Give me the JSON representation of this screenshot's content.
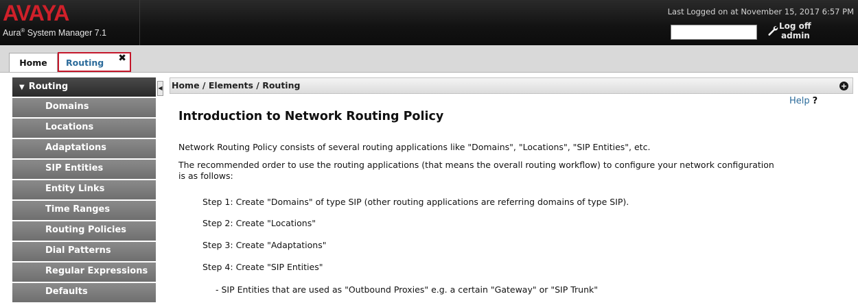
{
  "header": {
    "logo": "AVAYA",
    "product_name": "Aura",
    "product_reg": "®",
    "product_suffix": " System Manager 7.1",
    "last_logged": "Last Logged on at November 15, 2017 6:57 PM",
    "search_value": "",
    "logoff_label": "Log off",
    "user": "admin",
    "icons": {
      "logoff": "wrench-icon"
    }
  },
  "tabs": [
    {
      "label": "Home",
      "active": false
    },
    {
      "label": "Routing",
      "active": true,
      "close": "✖"
    }
  ],
  "sidebar": {
    "title": "Routing",
    "items": [
      {
        "label": "Domains"
      },
      {
        "label": "Locations"
      },
      {
        "label": "Adaptations"
      },
      {
        "label": "SIP Entities"
      },
      {
        "label": "Entity Links"
      },
      {
        "label": "Time Ranges"
      },
      {
        "label": "Routing Policies"
      },
      {
        "label": "Dial Patterns"
      },
      {
        "label": "Regular Expressions"
      },
      {
        "label": "Defaults"
      }
    ]
  },
  "main": {
    "breadcrumb": "Home / Elements / Routing",
    "help_label": "Help",
    "help_q": "?",
    "title": "Introduction to Network Routing Policy",
    "para1": "Network Routing Policy consists of several routing applications like \"Domains\", \"Locations\", \"SIP Entities\", etc.",
    "para2": "The recommended order to use the routing applications (that means the overall routing workflow) to configure your network configuration is as follows:",
    "steps": [
      "Step 1: Create \"Domains\" of type SIP (other routing applications are referring domains of type SIP).",
      "Step 2: Create \"Locations\"",
      "Step 3: Create \"Adaptations\"",
      "Step 4: Create \"SIP Entities\""
    ],
    "sub_step": "- SIP Entities that are used as \"Outbound Proxies\" e.g. a certain \"Gateway\" or \"SIP Trunk\""
  },
  "colors": {
    "brand_red": "#d0202a",
    "active_tab_border": "#c4162a",
    "link_blue": "#2a6a9a",
    "sidebar_item": "#7d7d7d",
    "sidebar_head": "#3a3a3a"
  }
}
